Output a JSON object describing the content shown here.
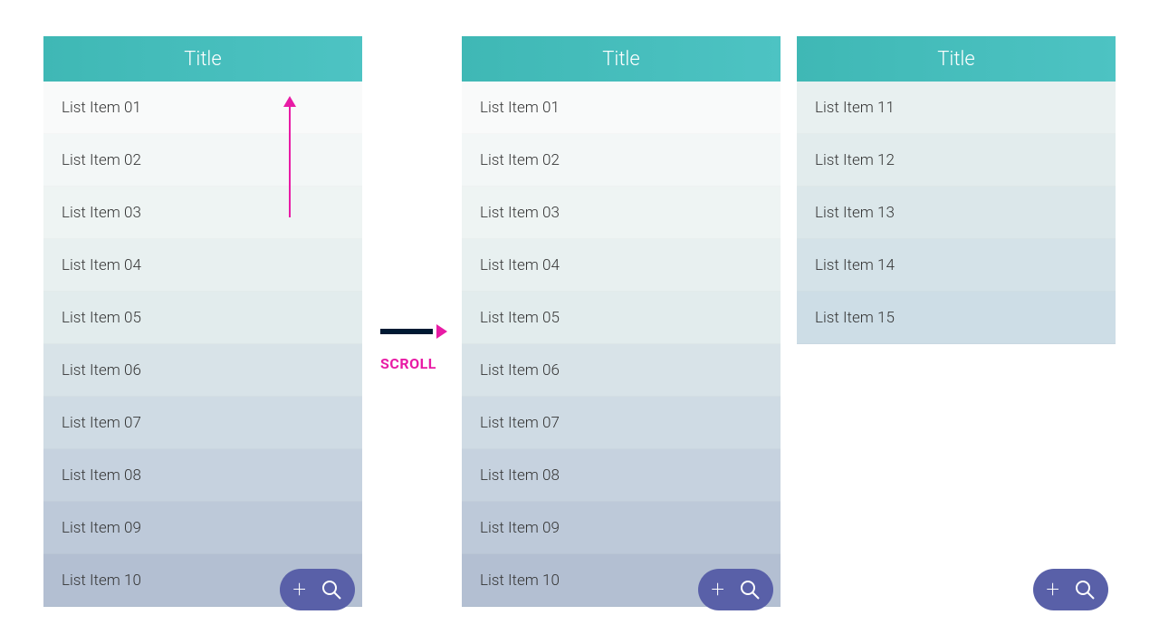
{
  "panels": [
    {
      "title": "Title",
      "items": [
        "List Item 01",
        "List Item 02",
        "List Item 03",
        "List Item 04",
        "List Item 05",
        "List Item 06",
        "List Item 07",
        "List Item 08",
        "List Item 09",
        "List Item 10"
      ]
    },
    {
      "title": "Title",
      "items": [
        "List Item 01",
        "List Item 02",
        "List Item 03",
        "List Item 04",
        "List Item 05",
        "List Item 06",
        "List Item 07",
        "List Item 08",
        "List Item 09",
        "List Item 10"
      ]
    },
    {
      "title": "Title",
      "items": [
        "List Item 11",
        "List Item 12",
        "List Item 13",
        "List Item 14",
        "List Item 15"
      ]
    }
  ],
  "annotation": {
    "scroll_label": "SCROLL"
  },
  "icons": {
    "plus": "+",
    "search": "search"
  },
  "colors": {
    "header": "#3fb8b5",
    "fab": "#5960a8",
    "accent": "#e81ba5"
  }
}
